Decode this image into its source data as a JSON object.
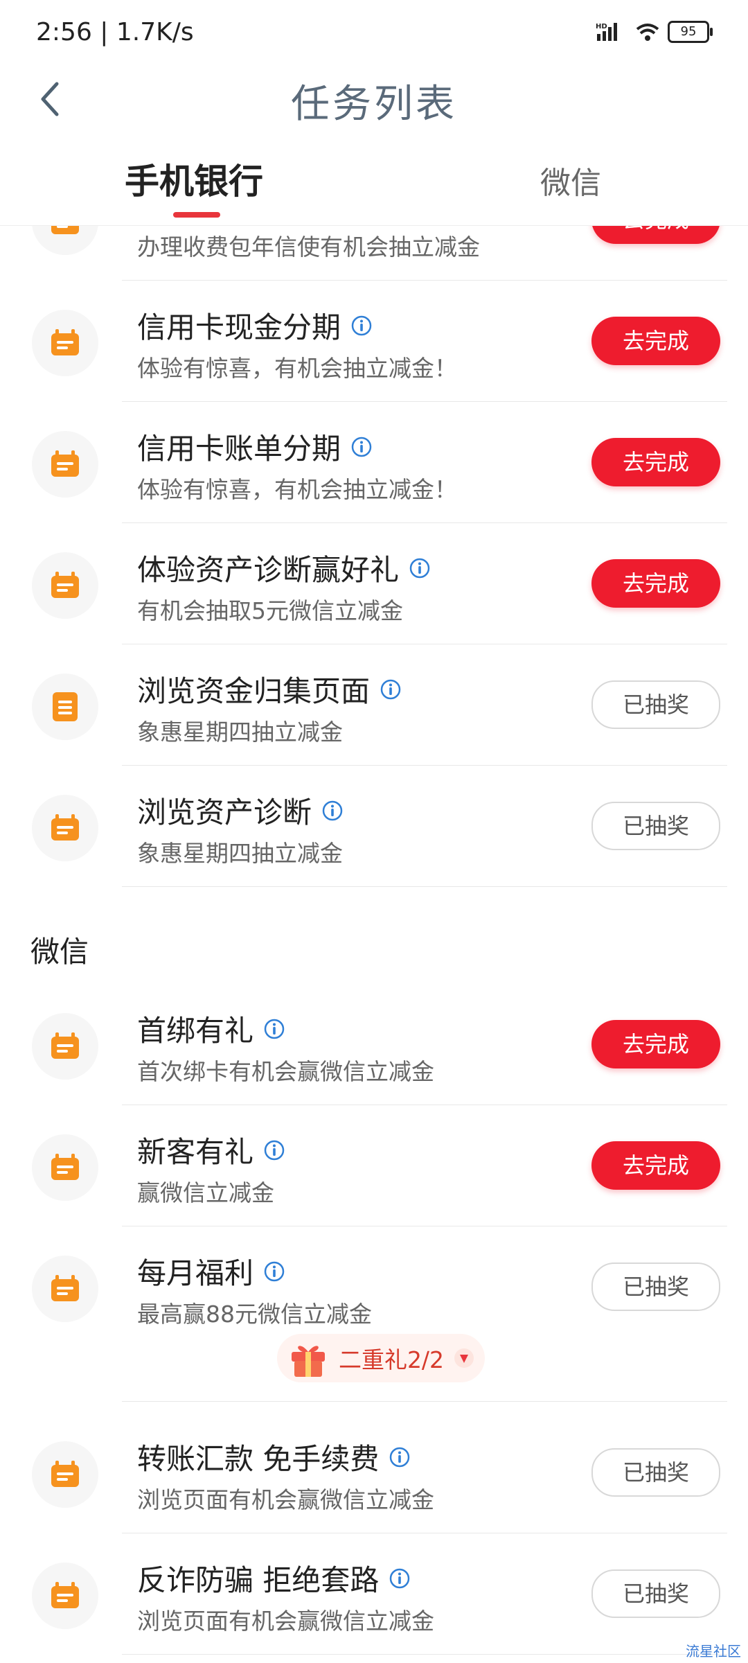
{
  "status_bar": {
    "time": "2:56 | 1.7K/s",
    "battery": "95",
    "signal_label": "HD"
  },
  "header": {
    "title": "任务列表"
  },
  "tabs": [
    {
      "label": "手机银行",
      "active": true
    },
    {
      "label": "微信",
      "active": false
    }
  ],
  "partial_task": {
    "subtitle": "办理收费包年信使有机会抽立减金",
    "button": "去完成"
  },
  "bank_tasks": [
    {
      "title": "信用卡现金分期",
      "subtitle": "体验有惊喜，有机会抽立减金！",
      "button": "去完成",
      "status": "todo",
      "icon": "calendar-icon"
    },
    {
      "title": "信用卡账单分期",
      "subtitle": "体验有惊喜，有机会抽立减金！",
      "button": "去完成",
      "status": "todo",
      "icon": "calendar-icon"
    },
    {
      "title": "体验资产诊断赢好礼",
      "subtitle": "有机会抽取5元微信立减金",
      "button": "去完成",
      "status": "todo",
      "icon": "calendar-icon"
    },
    {
      "title": "浏览资金归集页面",
      "subtitle": "象惠星期四抽立减金",
      "button": "已抽奖",
      "status": "done",
      "icon": "document-icon"
    },
    {
      "title": "浏览资产诊断",
      "subtitle": "象惠星期四抽立减金",
      "button": "已抽奖",
      "status": "done",
      "icon": "calendar-icon"
    }
  ],
  "wechat_section": {
    "title": "微信"
  },
  "wechat_tasks": [
    {
      "title": "首绑有礼",
      "subtitle": "首次绑卡有机会赢微信立减金",
      "button": "去完成",
      "status": "todo",
      "icon": "calendar-icon"
    },
    {
      "title": "新客有礼",
      "subtitle": "赢微信立减金",
      "button": "去完成",
      "status": "todo",
      "icon": "calendar-icon"
    },
    {
      "title": "每月福利",
      "subtitle": "最高赢88元微信立减金",
      "button": "已抽奖",
      "status": "done",
      "icon": "calendar-icon"
    }
  ],
  "gift": {
    "label": "二重礼2/2",
    "icon": "gift-icon"
  },
  "more_tasks": [
    {
      "title": "转账汇款 免手续费",
      "subtitle": "浏览页面有机会赢微信立减金",
      "button": "已抽奖",
      "status": "done",
      "icon": "calendar-icon"
    },
    {
      "title": "反诈防骗 拒绝套路",
      "subtitle": "浏览页面有机会赢微信立减金",
      "button": "已抽奖",
      "status": "done",
      "icon": "calendar-icon"
    }
  ],
  "watermark": "流星社区",
  "colors": {
    "accent": "#ee1c2e",
    "icon_orange": "#f6921e",
    "info_blue": "#2f7fd6"
  }
}
